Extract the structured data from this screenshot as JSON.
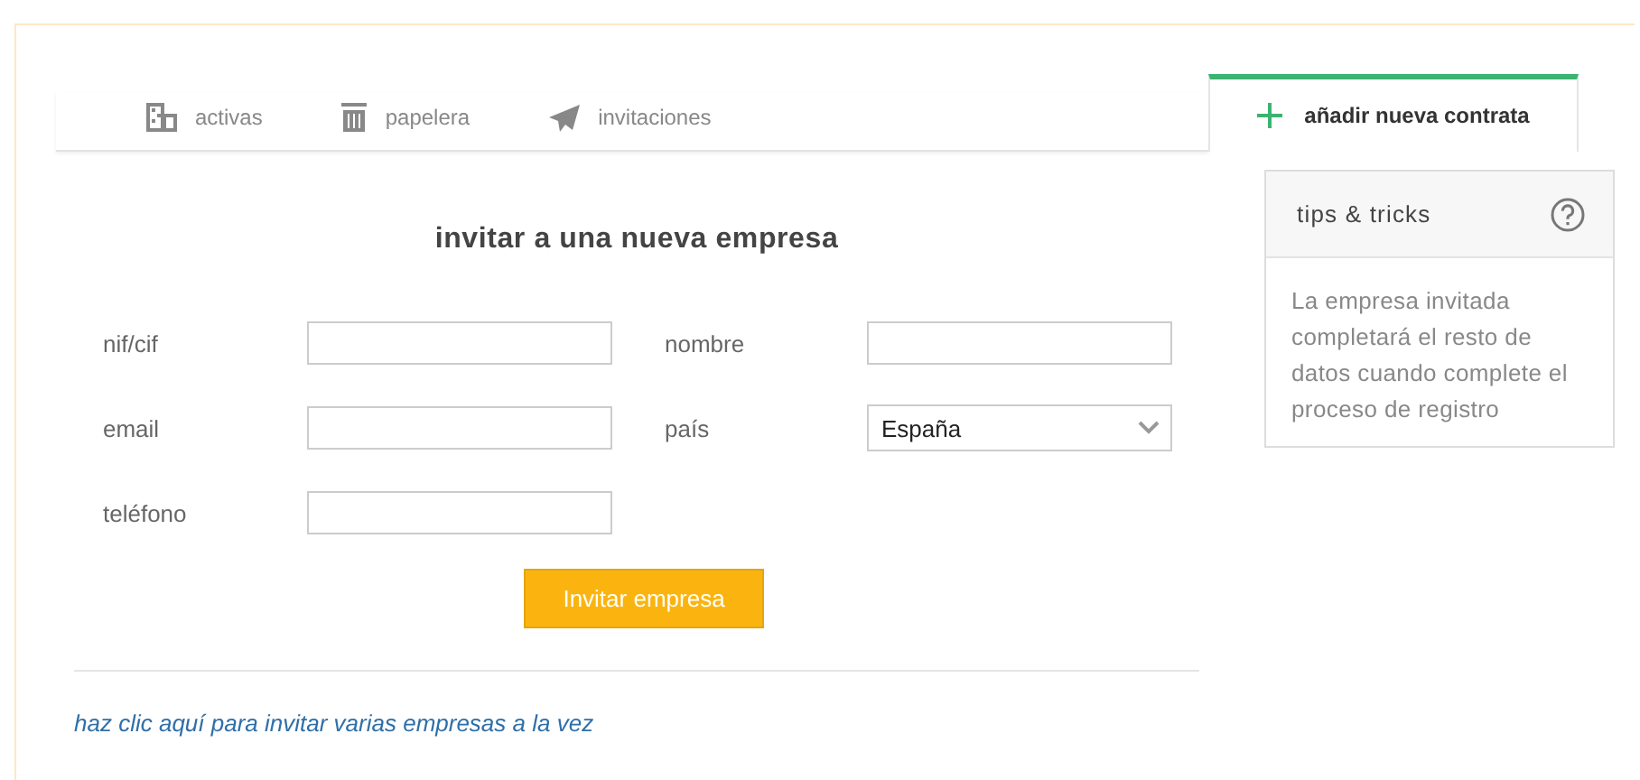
{
  "tabs": [
    {
      "label": "activas",
      "kind": "building",
      "selected": false
    },
    {
      "label": "papelera",
      "kind": "trash",
      "selected": false
    },
    {
      "label": "invitaciones",
      "kind": "plane",
      "selected": false
    },
    {
      "label": "añadir nueva contrata",
      "kind": "plus",
      "selected": true
    }
  ],
  "form": {
    "title": "invitar a una nueva empresa",
    "fields": [
      {
        "label": "nif/cif",
        "kind": "text"
      },
      {
        "label": "nombre",
        "kind": "text"
      },
      {
        "label": "email",
        "kind": "text"
      },
      {
        "label": "país",
        "kind": "select",
        "value": "España"
      },
      {
        "label": "teléfono",
        "kind": "text"
      }
    ],
    "submit": "Invitar empresa",
    "link": "haz clic aquí para invitar varias empresas a la vez"
  },
  "tips": {
    "title": "tips & tricks",
    "text": "La empresa invitada completará el resto de datos cuando complete el proceso de registro"
  }
}
